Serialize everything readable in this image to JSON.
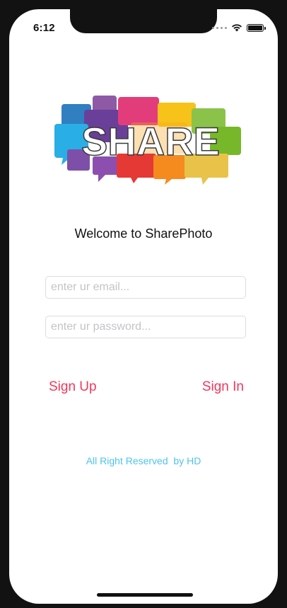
{
  "status_bar": {
    "time": "6:12"
  },
  "logo": {
    "text": "SHARE"
  },
  "welcome": {
    "text": "Welcome to SharePhoto"
  },
  "form": {
    "email_placeholder": "enter ur email...",
    "email_value": "",
    "password_placeholder": "enter ur password...",
    "password_value": ""
  },
  "actions": {
    "sign_up": "Sign Up",
    "sign_in": "Sign In"
  },
  "footer": {
    "text": "All Right Reserved  by HD"
  },
  "colors": {
    "accent": "#f5365c",
    "footer": "#4fc3ee"
  }
}
